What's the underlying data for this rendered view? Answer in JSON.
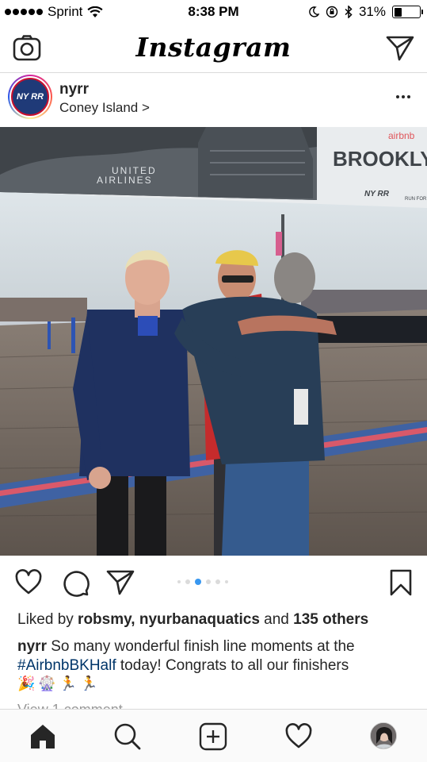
{
  "status_bar": {
    "carrier": "Sprint",
    "time": "8:38 PM",
    "battery": "31%",
    "battery_level": 0.31
  },
  "header": {
    "title": "Instagram"
  },
  "post": {
    "username": "nyrr",
    "location": "Coney Island >",
    "avatar_text": "NY RR"
  },
  "photo": {
    "banner_brooklyn": "BROOKLYN H",
    "banner_united": "UNITED",
    "banner_airlines": "AIRLINES",
    "banner_airbnb": "airbnb",
    "banner_nyrr": "NY RR",
    "banner_run": "RUN FOR"
  },
  "carousel": {
    "count": 6,
    "active_index": 2
  },
  "likes": {
    "prefix": "Liked by ",
    "user1": "robsmy",
    "separator": ", ",
    "user2": "nyurbanaquatics",
    "middle": " and ",
    "others": "135 others"
  },
  "caption": {
    "username": "nyrr",
    "text_part1": " So many wonderful finish line moments at the ",
    "hashtag": "#AirbnbBKHalf",
    "text_part2": " today! Congrats to all our finishers",
    "emojis": "🎉🎡🏃🏃"
  },
  "comments": {
    "view_label": "View 1 comment"
  },
  "icons": {
    "camera": "camera-icon",
    "direct": "paper-plane-icon",
    "more": "more-horizontal-icon",
    "like": "heart-icon",
    "comment": "comment-bubble-icon",
    "share": "paper-plane-icon",
    "save": "bookmark-icon",
    "home": "home-icon",
    "search": "search-icon",
    "add": "add-post-icon",
    "activity": "heart-icon",
    "profile": "profile-avatar"
  },
  "colors": {
    "link": "#003569",
    "active_dot": "#3897f0",
    "text": "#262626"
  }
}
